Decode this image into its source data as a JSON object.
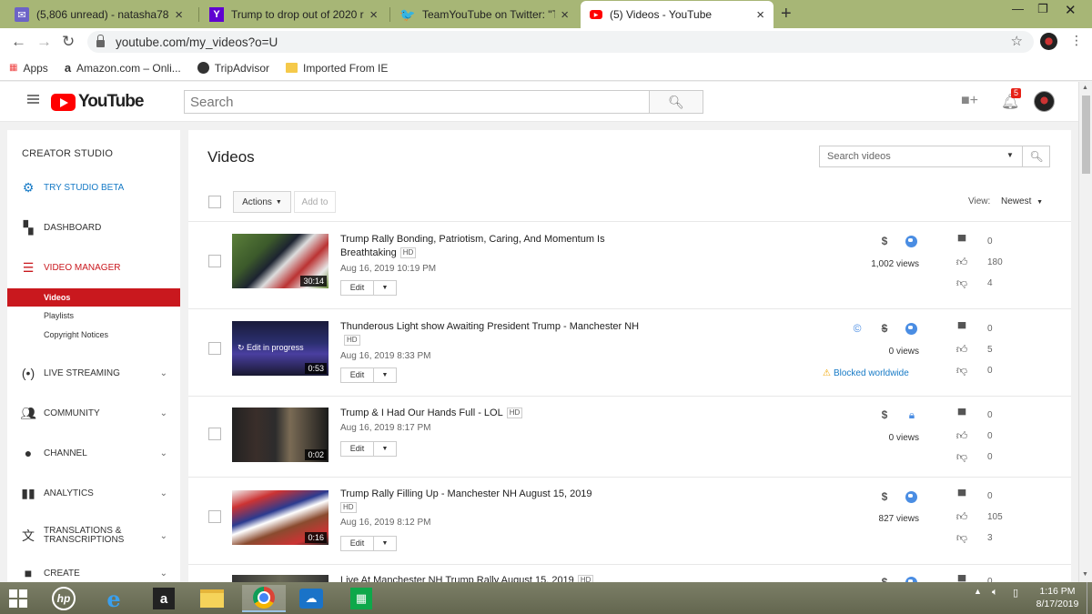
{
  "browser": {
    "tabs": [
      {
        "title": "(5,806 unread) - natasha78d@yah",
        "favicon": "mail-icon"
      },
      {
        "title": "Trump to drop out of 2020 race?",
        "favicon": "yahoo-icon"
      },
      {
        "title": "TeamYouTube on Twitter: \"There",
        "favicon": "twitter-icon"
      },
      {
        "title": "(5) Videos - YouTube",
        "favicon": "youtube-icon"
      }
    ],
    "url": "youtube.com/my_videos?o=U",
    "bookmarks": [
      {
        "label": "Apps",
        "icon": "apps-grid-icon"
      },
      {
        "label": "Amazon.com – Onli...",
        "icon": "amazon-icon"
      },
      {
        "label": "TripAdvisor",
        "icon": "tripadvisor-icon"
      },
      {
        "label": "Imported From IE",
        "icon": "folder-icon"
      }
    ]
  },
  "youtube": {
    "logo_text": "YouTube",
    "search_placeholder": "Search",
    "notification_count": "5",
    "brand_red": "#ff0000"
  },
  "sidebar": {
    "heading": "CREATOR STUDIO",
    "try_beta": "TRY STUDIO BETA",
    "dashboard": "DASHBOARD",
    "video_manager": "VIDEO MANAGER",
    "sub_items": [
      "Videos",
      "Playlists",
      "Copyright Notices"
    ],
    "sections": [
      {
        "label": "LIVE STREAMING",
        "icon": "live-icon"
      },
      {
        "label": "COMMUNITY",
        "icon": "community-icon"
      },
      {
        "label": "CHANNEL",
        "icon": "channel-icon"
      },
      {
        "label": "ANALYTICS",
        "icon": "analytics-icon"
      },
      {
        "label": "TRANSLATIONS & TRANSCRIPTIONS",
        "icon": "translate-icon"
      },
      {
        "label": "CREATE",
        "icon": "create-icon"
      }
    ]
  },
  "main": {
    "title": "Videos",
    "search_videos_placeholder": "Search videos",
    "actions_label": "Actions",
    "add_to_label": "Add to",
    "view_label": "View:",
    "view_value": "Newest",
    "hd_label": "HD",
    "edit_label": "Edit",
    "videos": [
      {
        "title": "Trump Rally Bonding, Patriotism, Caring, And Momentum Is Breathtaking",
        "date": "Aug 16, 2019 10:19 PM",
        "duration": "30:14",
        "views": "1,002 views",
        "comments": "0",
        "likes": "180",
        "dislikes": "4",
        "status_icons": [
          "monetized-icon",
          "public-icon"
        ]
      },
      {
        "title": "Thunderous Light show Awaiting President Trump - Manchester NH",
        "date": "Aug 16, 2019 8:33 PM",
        "duration": "0:53",
        "progress": "Edit in progress",
        "views": "0 views",
        "blocked": "Blocked worldwide",
        "comments": "0",
        "likes": "5",
        "dislikes": "0",
        "status_icons": [
          "copyright-icon",
          "not-monetized-icon",
          "public-icon"
        ]
      },
      {
        "title": "Trump & I Had Our Hands Full - LOL",
        "date": "Aug 16, 2019 8:17 PM",
        "duration": "0:02",
        "views": "0 views",
        "comments": "0",
        "likes": "0",
        "dislikes": "0",
        "status_icons": [
          "monetized-icon",
          "private-icon"
        ]
      },
      {
        "title": "Trump Rally Filling Up - Manchester NH August 15, 2019",
        "date": "Aug 16, 2019 8:12 PM",
        "duration": "0:16",
        "views": "827 views",
        "comments": "0",
        "likes": "105",
        "dislikes": "3",
        "status_icons": [
          "monetized-icon",
          "public-icon"
        ]
      },
      {
        "title": "Live At Manchester NH Trump Rally August 15, 2019",
        "date": "",
        "duration": "",
        "views": "",
        "comments": "0",
        "likes": "",
        "dislikes": ""
      }
    ]
  },
  "taskbar": {
    "time": "1:16 PM",
    "date": "8/17/2019"
  }
}
